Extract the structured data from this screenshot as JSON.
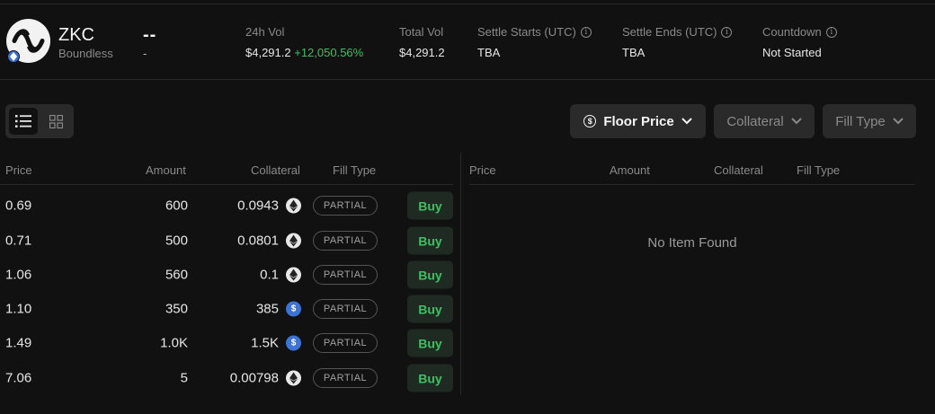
{
  "token": {
    "symbol": "ZKC",
    "name": "Boundless",
    "price": "--",
    "price_sub": "-"
  },
  "stats": [
    {
      "label": "24h Vol",
      "value": "$4,291.2",
      "change": "+12,050.56%",
      "info": false
    },
    {
      "label": "Total Vol",
      "value": "$4,291.2",
      "change": "",
      "info": false
    },
    {
      "label": "Settle Starts (UTC)",
      "value": "TBA",
      "change": "",
      "info": true
    },
    {
      "label": "Settle Ends (UTC)",
      "value": "TBA",
      "change": "",
      "info": true
    },
    {
      "label": "Countdown",
      "value": "Not Started",
      "change": "",
      "info": true
    }
  ],
  "filters": {
    "floor_price": "Floor Price",
    "collateral": "Collateral",
    "fill_type": "Fill Type"
  },
  "left_table": {
    "headers": {
      "price": "Price",
      "amount": "Amount",
      "collateral": "Collateral",
      "fill_type": "Fill Type"
    },
    "rows": [
      {
        "price": "0.69",
        "amount": "600",
        "collateral": "0.0943",
        "coin": "eth",
        "fill": "PARTIAL",
        "action": "Buy"
      },
      {
        "price": "0.71",
        "amount": "500",
        "collateral": "0.0801",
        "coin": "eth",
        "fill": "PARTIAL",
        "action": "Buy"
      },
      {
        "price": "1.06",
        "amount": "560",
        "collateral": "0.1",
        "coin": "eth",
        "fill": "PARTIAL",
        "action": "Buy"
      },
      {
        "price": "1.10",
        "amount": "350",
        "collateral": "385",
        "coin": "usdc",
        "fill": "PARTIAL",
        "action": "Buy"
      },
      {
        "price": "1.49",
        "amount": "1.0K",
        "collateral": "1.5K",
        "coin": "usdc",
        "fill": "PARTIAL",
        "action": "Buy"
      },
      {
        "price": "7.06",
        "amount": "5",
        "collateral": "0.00798",
        "coin": "eth",
        "fill": "PARTIAL",
        "action": "Buy"
      }
    ]
  },
  "right_table": {
    "headers": {
      "price": "Price",
      "amount": "Amount",
      "collateral": "Collateral",
      "fill_type": "Fill Type"
    },
    "empty_text": "No Item Found"
  },
  "icons": {
    "logo": "boundless-logo-icon",
    "chain": "chain-badge-icon",
    "eth": "eth-icon",
    "usdc": "usdc-icon"
  },
  "colors": {
    "accent_green": "#3fbf63",
    "background": "#111111",
    "panel": "#2a2a2a",
    "usdc_blue": "#3b74d6"
  }
}
